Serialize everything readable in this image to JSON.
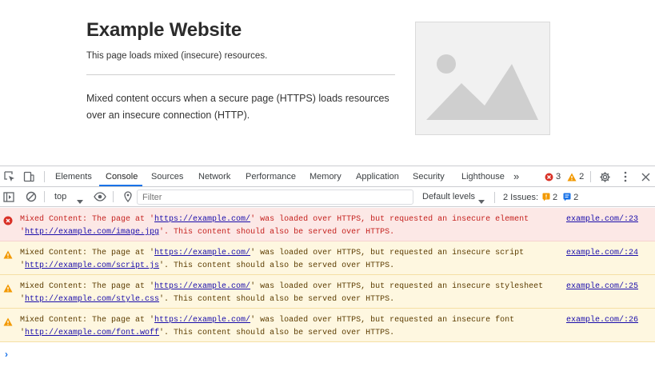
{
  "page": {
    "title": "Example Website",
    "subtitle": "This page loads mixed (insecure) resources.",
    "paragraph": "Mixed content occurs when a secure page (HTTPS) loads resources over an insecure connection (HTTP)."
  },
  "devtools": {
    "tabs": [
      {
        "label": "Elements"
      },
      {
        "label": "Console"
      },
      {
        "label": "Sources"
      },
      {
        "label": "Network"
      },
      {
        "label": "Performance"
      },
      {
        "label": "Memory"
      },
      {
        "label": "Application"
      },
      {
        "label": "Security"
      },
      {
        "label": "Lighthouse"
      }
    ],
    "active_tab": "Console",
    "more_tabs": "»",
    "error_count": "3",
    "warning_count": "2",
    "toolbar": {
      "context": "top",
      "filter_placeholder": "Filter",
      "levels": "Default levels",
      "issues_label": "2 Issues:",
      "issues_warning": "2",
      "issues_info": "2"
    },
    "messages": [
      {
        "level": "error",
        "line1_prefix": "Mixed Content:  The page at '",
        "page_url": "https://example.com/",
        "line1_suffix": "' was loaded over HTTPS, but requested an insecure element",
        "line2_prefix": "'",
        "resource_url": "http://example.com/image.jpg",
        "line2_suffix": "'. This content should also be served over HTTPS.",
        "source": "example.com/:23"
      },
      {
        "level": "warning",
        "line1_prefix": "Mixed Content:  The page at '",
        "page_url": "https://example.com/",
        "line1_suffix": "' was loaded over HTTPS, but requested an insecure script",
        "line2_prefix": "'",
        "resource_url": "http://example.com/script.js",
        "line2_suffix": "'. This content should also be served over HTTPS.",
        "source": "example.com/:24"
      },
      {
        "level": "warning",
        "line1_prefix": "Mixed Content:  The page at '",
        "page_url": "https://example.com/",
        "line1_suffix": "' was loaded over HTTPS, but requested an insecure stylesheet",
        "line2_prefix": "'",
        "resource_url": "http://example.com/style.css",
        "line2_suffix": "'. This content should also be served over HTTPS.",
        "source": "example.com/:25"
      },
      {
        "level": "warning",
        "line1_prefix": "Mixed Content:  The page at '",
        "page_url": "https://example.com/",
        "line1_suffix": "' was loaded over HTTPS, but requested an insecure font",
        "line2_prefix": "'",
        "resource_url": "http://example.com/font.woff",
        "line2_suffix": "'. This content should also be served over HTTPS.",
        "source": "example.com/:26"
      }
    ],
    "prompt_symbol": "›"
  },
  "icons": {
    "inspect": "inspect-element-icon",
    "device": "device-toolbar-icon",
    "error": "error-circle-icon",
    "warning": "warning-triangle-icon",
    "settings": "gear-icon",
    "menu": "kebab-menu-icon",
    "close": "close-icon",
    "sidebar": "sidebar-toggle-icon",
    "clear": "clear-console-icon",
    "eye": "live-expression-eye-icon",
    "filter": "filter-icon",
    "issue_info": "info-message-icon"
  },
  "colors": {
    "accent": "#1a73e8",
    "error_bg": "#fce8e6",
    "error_text": "#c5221f",
    "warning_bg": "#fef7e0",
    "warning_text": "#5c3c00",
    "error_icon": "#d93025",
    "warning_icon": "#f29900"
  }
}
